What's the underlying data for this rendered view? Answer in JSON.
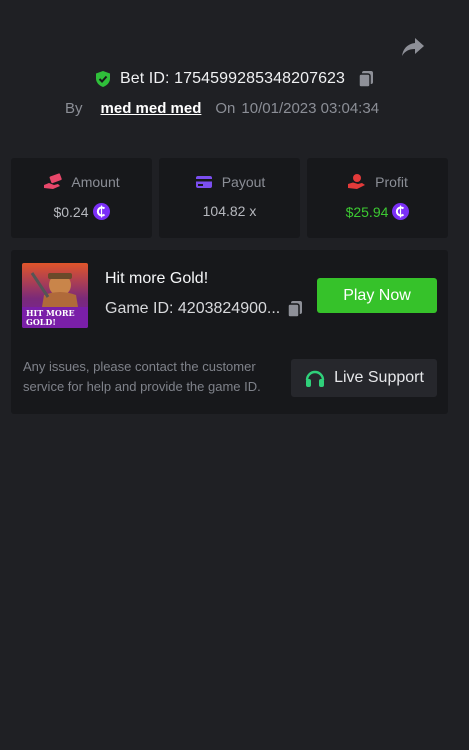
{
  "header": {
    "share_icon": "share-arrow-icon",
    "bet_label": "Bet ID: 1754599285348207623",
    "by_label": "By",
    "username": "med med med",
    "on_label": "On",
    "date": "10/01/2023 03:04:34"
  },
  "stats": {
    "amount": {
      "label": "Amount",
      "value": "$0.24",
      "icon": "money-hand-icon",
      "color": "#e8476a"
    },
    "payout": {
      "label": "Payout",
      "value": "104.82 x",
      "icon": "card-icon",
      "color": "#7b4ef0"
    },
    "profit": {
      "label": "Profit",
      "value": "$25.94",
      "icon": "hand-coin-icon",
      "color": "#e33a3a",
      "value_color": "#3cc832"
    }
  },
  "game": {
    "title": "Hit more Gold!",
    "thumb_text_line1": "HIT MORE",
    "thumb_text_line2": "GOLD!",
    "id_label": "Game ID: 4203824900...",
    "play_label": "Play Now",
    "support_text": "Any issues, please contact the customer service for help and provide the game ID.",
    "support_label": "Live Support"
  },
  "colors": {
    "background": "#1f2024",
    "card": "#17181b",
    "accent_green": "#36c22a",
    "coin_purple": "#7b2ff7"
  }
}
